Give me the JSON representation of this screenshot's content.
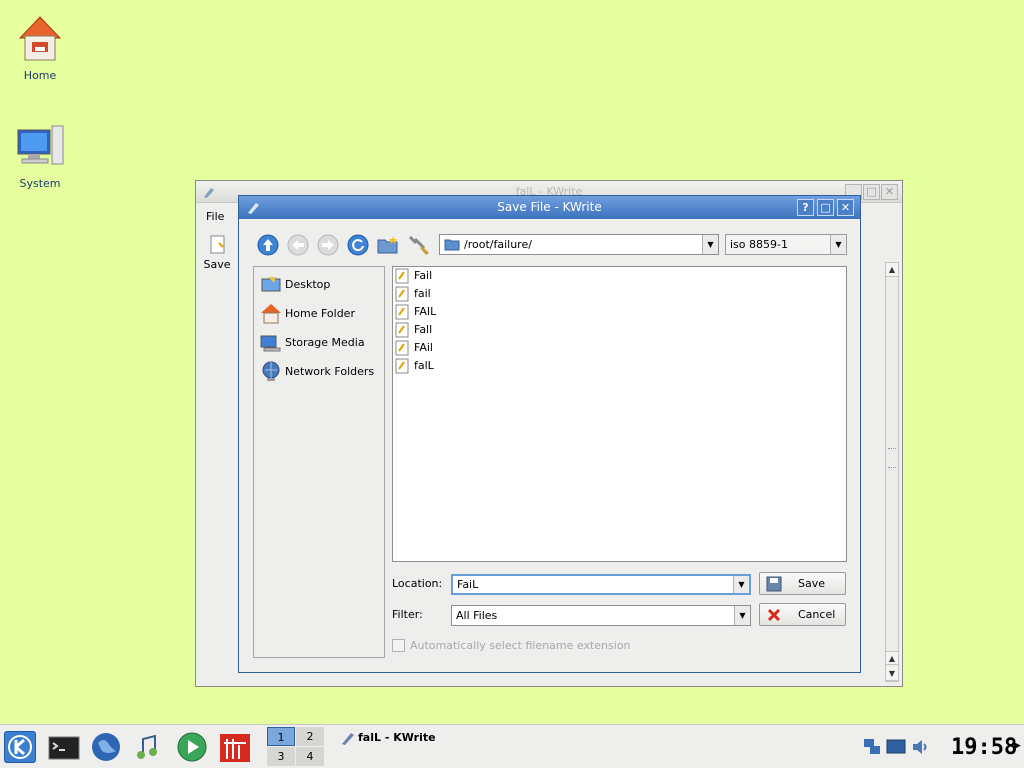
{
  "desktop": {
    "icons": [
      {
        "label": "Home",
        "icon": "home-icon"
      },
      {
        "label": "System",
        "icon": "computer-icon"
      }
    ]
  },
  "bg_window": {
    "title": "falL - KWrite",
    "menu_file": "File",
    "toolbar_save": "Save"
  },
  "dialog": {
    "title": "Save File - KWrite",
    "path": "/root/failure/",
    "encoding": "iso 8859-1",
    "sidebar": [
      "Desktop",
      "Home Folder",
      "Storage Media",
      "Network Folders"
    ],
    "files": [
      "Fail",
      "fail",
      "FAIL",
      "Fall",
      "FAil",
      "falL"
    ],
    "location_label": "Location:",
    "location_value": "FaiL",
    "filter_label": "Filter:",
    "filter_value": "All Files",
    "save_label": "Save",
    "cancel_label": "Cancel",
    "auto_ext_label": "Automatically select filename extension"
  },
  "taskbar": {
    "pager": [
      "1",
      "2",
      "3",
      "4"
    ],
    "task_title": "falL - KWrite",
    "clock": "19:58"
  },
  "colors": {
    "desktop_bg": "#e6ff9e",
    "titlebar_active": "#4a7fc7"
  }
}
